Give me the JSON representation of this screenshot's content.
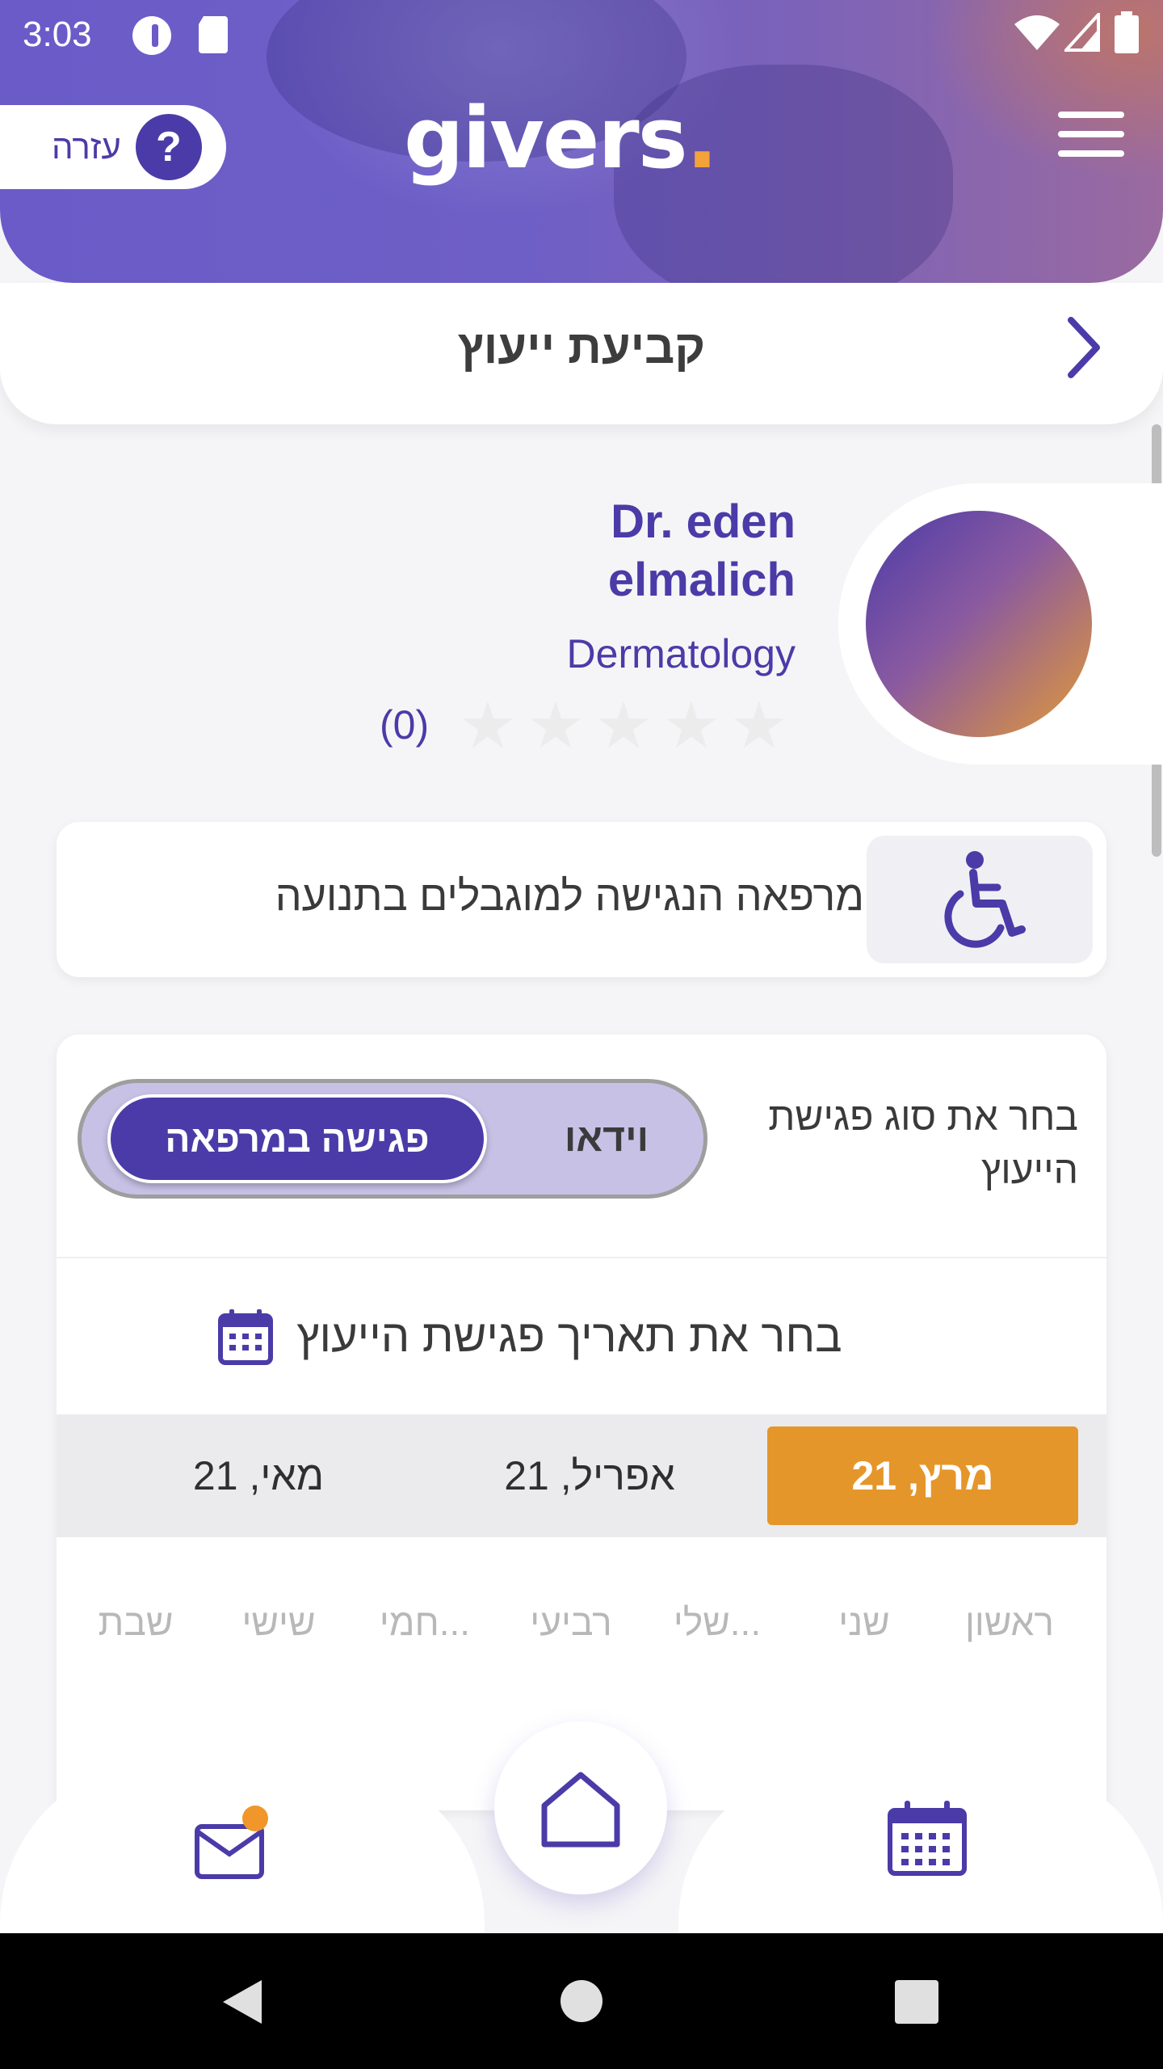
{
  "status_bar": {
    "time": "3:03"
  },
  "header": {
    "logo_text": "givers",
    "logo_dot": ".",
    "help_label": "עזרה",
    "help_icon_text": "?"
  },
  "title_bar": {
    "title": "קביעת ייעוץ"
  },
  "doctor": {
    "name_line1": "Dr. eden",
    "name_line2": "elmalich",
    "specialty": "Dermatology",
    "rating_count": "(0)",
    "rating_value": 0,
    "rating_max": 5
  },
  "accessibility": {
    "text": "מרפאה הנגישה למוגבלים בתנועה",
    "icon": "wheelchair-icon"
  },
  "booking": {
    "meeting_type_label": "בחר את סוג פגישת הייעוץ",
    "toggle_options": [
      "וידאו",
      "פגישה במרפאה"
    ],
    "selected_option": "פגישה במרפאה",
    "date_label": "בחר את תאריך פגישת הייעוץ",
    "months": [
      "מרץ, 21",
      "אפריל, 21",
      "מאי, 21"
    ],
    "selected_month": "מרץ, 21",
    "weekdays": [
      "ראשון",
      "שני",
      "שלי...",
      "רביעי",
      "חמי...",
      "שישי",
      "שבת"
    ]
  },
  "bottom_nav": {
    "items": [
      "mail-icon",
      "home-icon",
      "calendar-icon"
    ],
    "mail_has_notification": true
  },
  "colors": {
    "brand_purple": "#4b3ba8",
    "accent_orange": "#e5962a",
    "notification_dot": "#f0962a"
  }
}
